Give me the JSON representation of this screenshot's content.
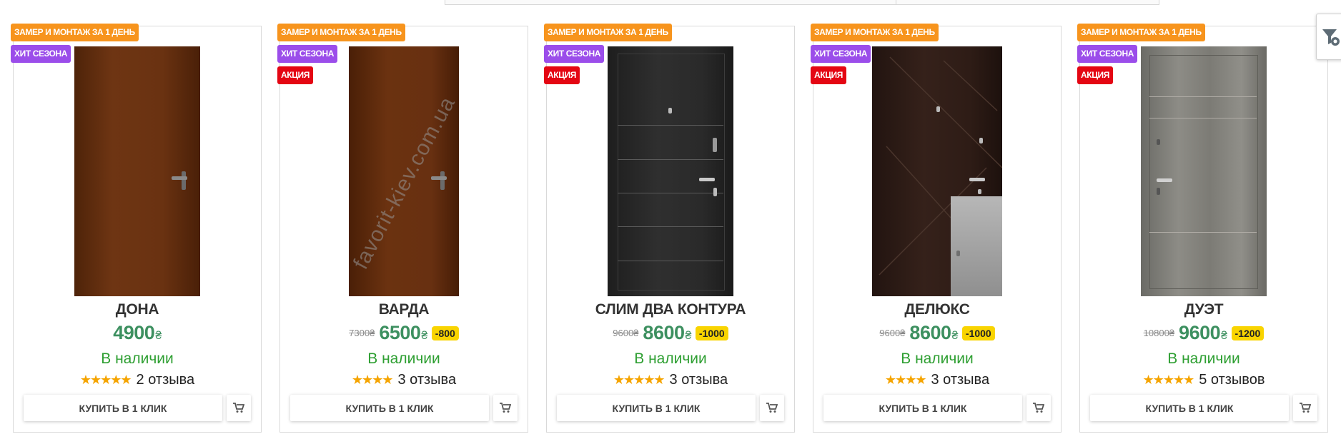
{
  "colors": {
    "badge_orange": "#f7941d",
    "badge_purple": "#9b4dea",
    "badge_red": "#e40613",
    "price_green": "#3d9060",
    "stock_green": "#2e9f32",
    "discount_yellow": "#f9d400",
    "star_orange": "#f5a400"
  },
  "icons": {
    "cart": "cart-icon",
    "filter": "filter-icon",
    "stars": "star-icon"
  },
  "products": [
    {
      "badges": [
        {
          "text": "ЗАМЕР И МОНТАЖ ЗА 1 ДЕНЬ",
          "color": "orange"
        },
        {
          "text": "ХИТ СЕЗОНА",
          "color": "purple"
        }
      ],
      "name": "ДОНА",
      "old_price": "",
      "price": "4900",
      "currency": "₴",
      "discount": "",
      "stock": "В наличии",
      "stars": "★★★★★",
      "rating": 5,
      "reviews": "2 отзыва",
      "buy_label": "КУПИТЬ В 1 КЛИК"
    },
    {
      "badges": [
        {
          "text": "ЗАМЕР И МОНТАЖ ЗА 1 ДЕНЬ",
          "color": "orange"
        },
        {
          "text": "ХИТ СЕЗОНА",
          "color": "purple"
        },
        {
          "text": "АКЦИЯ",
          "color": "red"
        }
      ],
      "name": "ВАРДА",
      "old_price": "7300₴",
      "price": "6500",
      "currency": "₴",
      "discount": "-800",
      "stock": "В наличии",
      "stars": "★★★★",
      "rating": 4,
      "reviews": "3 отзыва",
      "buy_label": "КУПИТЬ В 1 КЛИК",
      "watermark": "favorit-kiev.com.ua"
    },
    {
      "badges": [
        {
          "text": "ЗАМЕР И МОНТАЖ ЗА 1 ДЕНЬ",
          "color": "orange"
        },
        {
          "text": "ХИТ СЕЗОНА",
          "color": "purple"
        },
        {
          "text": "АКЦИЯ",
          "color": "red"
        }
      ],
      "name": "СЛИМ ДВА КОНТУРА",
      "old_price": "9600₴",
      "price": "8600",
      "currency": "₴",
      "discount": "-1000",
      "stock": "В наличии",
      "stars": "★★★★★",
      "rating": 5,
      "reviews": "3 отзыва",
      "buy_label": "КУПИТЬ В 1 КЛИК"
    },
    {
      "badges": [
        {
          "text": "ЗАМЕР И МОНТАЖ ЗА 1 ДЕНЬ",
          "color": "orange"
        },
        {
          "text": "ХИТ СЕЗОНА",
          "color": "purple"
        },
        {
          "text": "АКЦИЯ",
          "color": "red"
        }
      ],
      "name": "ДЕЛЮКС",
      "old_price": "9600₴",
      "price": "8600",
      "currency": "₴",
      "discount": "-1000",
      "stock": "В наличии",
      "stars": "★★★★",
      "rating": 4,
      "reviews": "3 отзыва",
      "buy_label": "КУПИТЬ В 1 КЛИК"
    },
    {
      "badges": [
        {
          "text": "ЗАМЕР И МОНТАЖ ЗА 1 ДЕНЬ",
          "color": "orange"
        },
        {
          "text": "ХИТ СЕЗОНА",
          "color": "purple"
        },
        {
          "text": "АКЦИЯ",
          "color": "red"
        }
      ],
      "name": "ДУЭТ",
      "old_price": "10800₴",
      "price": "9600",
      "currency": "₴",
      "discount": "-1200",
      "stock": "В наличии",
      "stars": "★★★★★",
      "rating": 5,
      "reviews": "5 отзывов",
      "buy_label": "КУПИТЬ В 1 КЛИК"
    }
  ]
}
